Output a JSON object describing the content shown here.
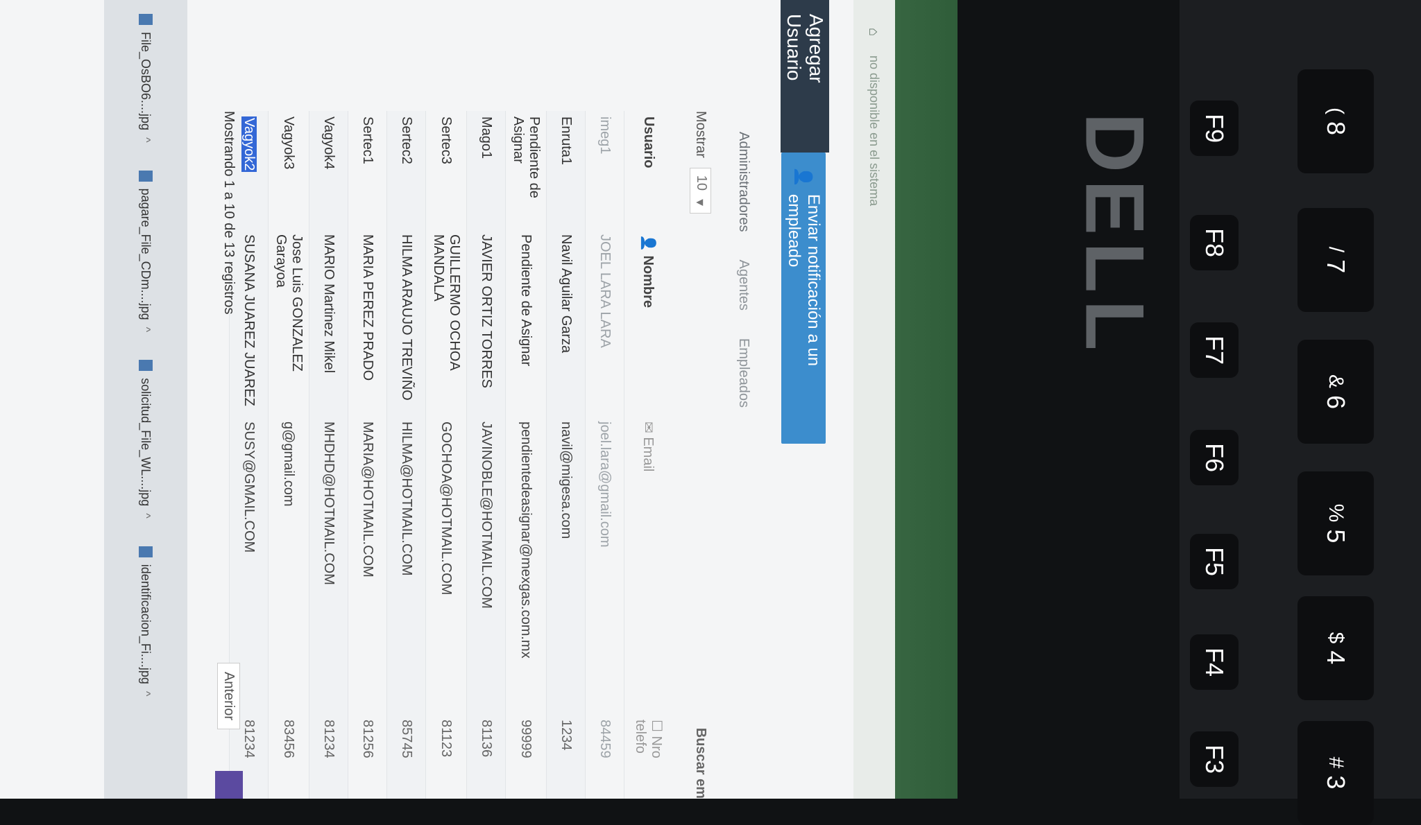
{
  "topbar": {
    "breadcrumb": "no disponible en el sistema"
  },
  "sidebar": {
    "title": "Agregar Usuario"
  },
  "actions": {
    "notify_label": "Enviar notificación a un empleado"
  },
  "tabs": [
    {
      "label": "Administradores"
    },
    {
      "label": "Agentes"
    },
    {
      "label": "Empleados"
    }
  ],
  "controls": {
    "show_label": "Mostrar",
    "page_size": "10",
    "search_label": "Buscar em"
  },
  "table": {
    "headers": {
      "user": "Usuario",
      "name": "Nombre",
      "email": "Email",
      "phone": "Nro telefo"
    },
    "rows": [
      {
        "user": "imeg1",
        "name": "JOEL LARA LARA",
        "email": "joel.lara@gmail.com",
        "phone": "84459"
      },
      {
        "user": "Enruta1",
        "name": "Navil Aguilar Garza",
        "email": "navil@migesa.com",
        "phone": "1234"
      },
      {
        "user": "Pendiente de Asignar",
        "name": "Pendiente de Asignar",
        "email": "pendientedeasignar@mexgas.com.mx",
        "phone": "99999"
      },
      {
        "user": "Mago1",
        "name": "JAVIER ORTIZ TORRES",
        "email": "JAVINOBLE@HOTMAIL.COM",
        "phone": "81136"
      },
      {
        "user": "Sertec3",
        "name": "GUILLERMO OCHOA MANDALA",
        "email": "GOCHOA@HOTMAIL.COM",
        "phone": "81123"
      },
      {
        "user": "Sertec2",
        "name": "HILMA ARAUJO TREVIÑO",
        "email": "HILMA@HOTMAIL.COM",
        "phone": "85745"
      },
      {
        "user": "Sertec1",
        "name": "MARIA PEREZ PRADO",
        "email": "MARIA@HOTMAIL.COM",
        "phone": "81256"
      },
      {
        "user": "Vagyok4",
        "name": "MARIO Martinez Mikel",
        "email": "MHDHD@HOTMAIL.COM",
        "phone": "81234"
      },
      {
        "user": "Vagyok3",
        "name": "Jose Luis GONZALEZ Garayoa",
        "email": "g@gmail.com",
        "phone": "83456"
      },
      {
        "user": "Vagyok2",
        "name": "SUSANA JUAREZ JUAREZ",
        "email": "SUSY@GMAIL.COM",
        "phone": "81234"
      }
    ]
  },
  "footer": {
    "info": "Mostrando 1 a 10 de 13 registros",
    "prev_label": "Anterior"
  },
  "downloads": [
    {
      "name": "File_OsBO6....jpg"
    },
    {
      "name": "pagare_File_CDm....jpg"
    },
    {
      "name": "solicitud_File_WL....jpg"
    },
    {
      "name": "identificacion_Fi....jpg"
    }
  ],
  "laptop": {
    "brand": "DELL",
    "keys": [
      {
        "main": "F3"
      },
      {
        "main": "F4"
      },
      {
        "main": "F5"
      },
      {
        "main": "F6"
      },
      {
        "main": "F7"
      },
      {
        "main": "F8"
      },
      {
        "main": "F9"
      }
    ],
    "number_keys": [
      {
        "top": "#",
        "main": "3"
      },
      {
        "top": "$",
        "main": "4"
      },
      {
        "top": "%",
        "main": "5"
      },
      {
        "top": "&",
        "main": "6"
      },
      {
        "top": "/",
        "main": "7"
      },
      {
        "top": "(",
        "main": "8"
      }
    ]
  }
}
